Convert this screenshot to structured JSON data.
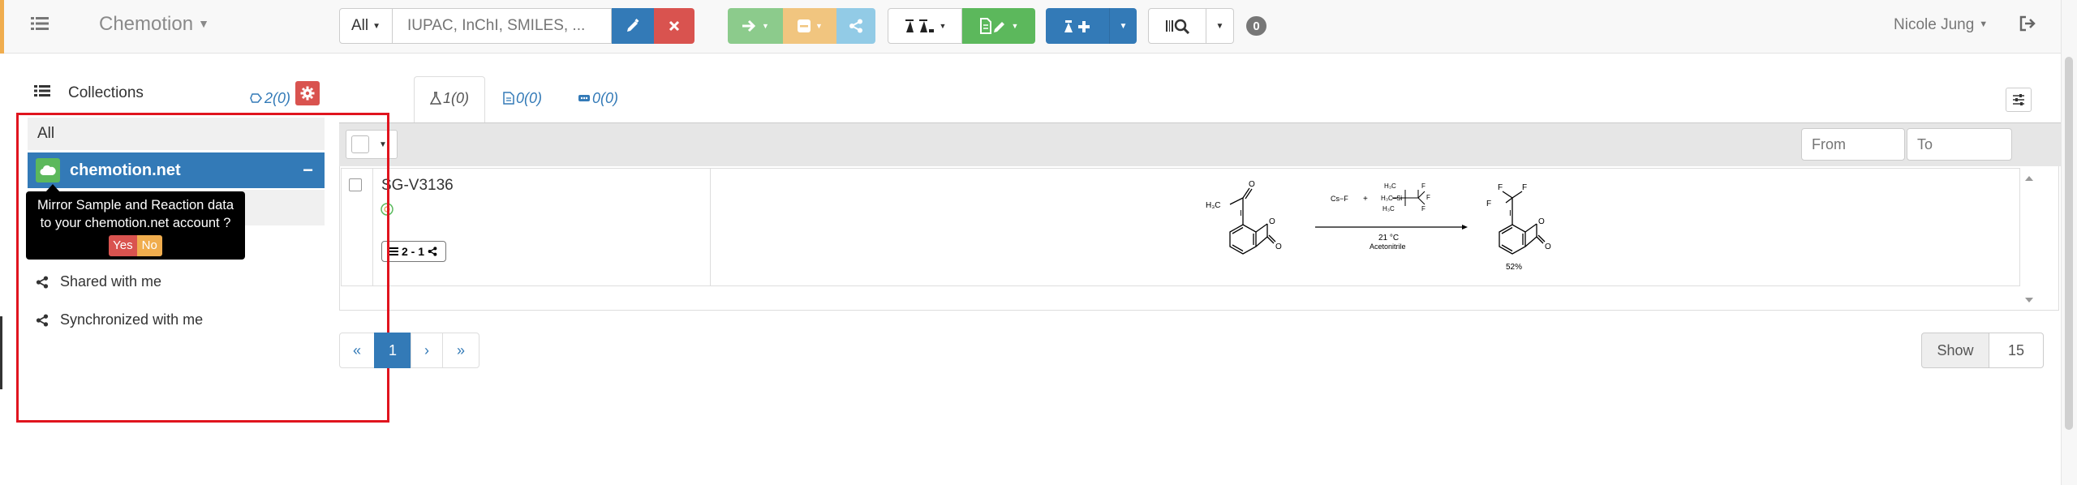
{
  "navbar": {
    "brand": "Chemotion",
    "search": {
      "scope": "All",
      "placeholder": "IUPAC, InChI, SMILES, ..."
    },
    "notification_count": "0",
    "user_name": "Nicole Jung"
  },
  "sidebar": {
    "title": "Collections",
    "all_label": "All",
    "selected_collection": "chemotion.net",
    "tooltip": {
      "line1": "Mirror Sample and Reaction data",
      "line2": "to your chemotion.net account ?",
      "yes": "Yes",
      "no": "No"
    },
    "items": [
      {
        "label": "Shared with me"
      },
      {
        "label": "Synchronized with me"
      }
    ]
  },
  "tabs": [
    {
      "label": "2(0)",
      "icon": "reaction-icon"
    },
    {
      "label": "1(0)",
      "icon": "sample-flask-icon"
    },
    {
      "label": "0(0)",
      "icon": "wellplate-icon"
    },
    {
      "label": "0(0)",
      "icon": "screen-icon"
    }
  ],
  "filters": {
    "from_placeholder": "From",
    "to_placeholder": "To"
  },
  "list": {
    "rows": [
      {
        "name": "SG-V3136",
        "tag": "2 - 1",
        "scheme": {
          "reagent1": "Cs−F",
          "plus": "+",
          "temperature": "21 °C",
          "solvent": "Acetonitrile",
          "yield": "52%"
        }
      }
    ]
  },
  "pagination": {
    "first": "«",
    "current": "1",
    "next": "›",
    "last": "»"
  },
  "show": {
    "label": "Show",
    "value": "15"
  },
  "colors": {
    "primary": "#337ab7",
    "danger": "#d9534f",
    "success": "#5cb85c",
    "warning": "#f0ad4e",
    "highlight": "#e0141e"
  }
}
